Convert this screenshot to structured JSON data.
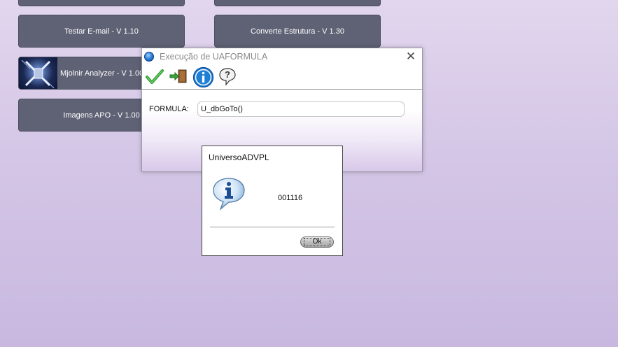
{
  "tiles": {
    "testar_email": "Testar E-mail - V 1.10",
    "converte_estrutura": "Converte Estrutura - V 1.30",
    "mjolnir": "Mjolnir Analyzer - V 1.00",
    "imagens_apo": "Imagens APO - V 1.00"
  },
  "dialog": {
    "title": "Execução de UAFORMULA",
    "close_glyph": "✕",
    "toolbar": {
      "icons": [
        "check-icon",
        "exit-door-icon",
        "info-icon",
        "help-icon"
      ]
    },
    "form_label": "FORMULA:",
    "form_value": "U_dbGoTo()"
  },
  "msgbox": {
    "title": "UniversoADVPL",
    "message": "001116",
    "ok_label": "Ok"
  },
  "colors": {
    "tile_bg": "#5f6275",
    "check_green": "#2e9e2e",
    "info_blue": "#1f7fd4"
  }
}
